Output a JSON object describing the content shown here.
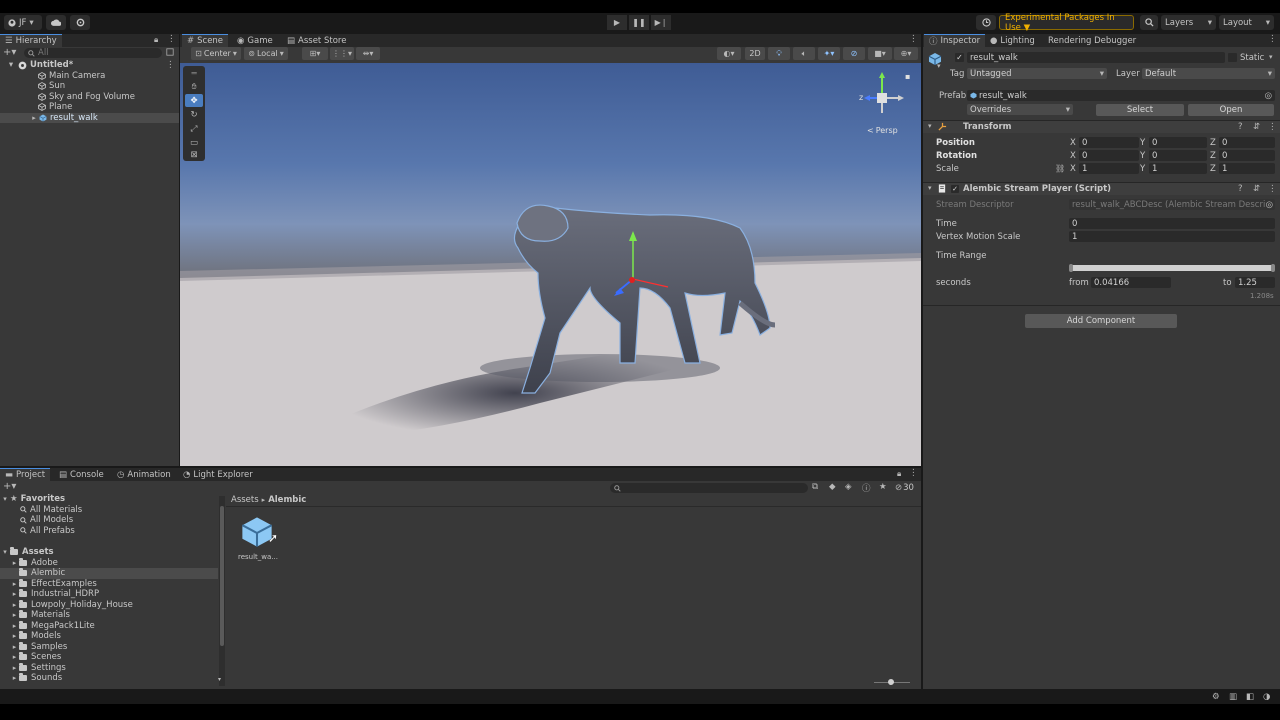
{
  "topbar": {
    "account": "JF",
    "experimental_label": "Experimental Packages In Use ▼",
    "layers_label": "Layers",
    "layout_label": "Layout"
  },
  "hierarchy": {
    "tab_label": "Hierarchy",
    "search_placeholder": "All",
    "scene_name": "Untitled*",
    "items": [
      {
        "label": "Main Camera"
      },
      {
        "label": "Sun"
      },
      {
        "label": "Sky and Fog Volume"
      },
      {
        "label": "Plane"
      },
      {
        "label": "result_walk"
      }
    ]
  },
  "scene": {
    "tabs": [
      {
        "label": "Scene"
      },
      {
        "label": "Game"
      },
      {
        "label": "Asset Store"
      }
    ],
    "pivot_label": "Center",
    "space_label": "Local",
    "mode_2d": "2D",
    "persp_label": "Persp",
    "gizmo_z": "z",
    "gizmo_x": "x"
  },
  "inspector": {
    "tabs": [
      {
        "label": "Inspector"
      },
      {
        "label": "Lighting"
      },
      {
        "label": "Rendering Debugger"
      }
    ],
    "object_name": "result_walk",
    "static_label": "Static",
    "tag_label": "Tag",
    "tag_value": "Untagged",
    "layer_label": "Layer",
    "layer_value": "Default",
    "prefab_label": "Prefab",
    "prefab_value": "result_walk",
    "overrides_label": "Overrides",
    "select_label": "Select",
    "open_label": "Open",
    "transform": {
      "title": "Transform",
      "position_label": "Position",
      "rotation_label": "Rotation",
      "scale_label": "Scale",
      "axis_x": "X",
      "axis_y": "Y",
      "axis_z": "Z",
      "position": [
        "0",
        "0",
        "0"
      ],
      "rotation": [
        "0",
        "0",
        "0"
      ],
      "scale": [
        "1",
        "1",
        "1"
      ]
    },
    "alembic": {
      "title": "Alembic Stream Player (Script)",
      "stream_descriptor_label": "Stream Descriptor",
      "stream_descriptor_value": "result_walk_ABCDesc (Alembic Stream Descripto",
      "time_label": "Time",
      "time_value": "0",
      "vms_label": "Vertex Motion Scale",
      "vms_value": "1",
      "time_range_label": "Time Range",
      "seconds_label": "seconds",
      "from_label": "from",
      "from_value": "0.04166",
      "to_label": "to",
      "to_value": "1.25",
      "duration": "1.208s"
    },
    "add_component_label": "Add Component"
  },
  "project": {
    "tabs": [
      {
        "label": "Project"
      },
      {
        "label": "Console"
      },
      {
        "label": "Animation"
      },
      {
        "label": "Light Explorer"
      }
    ],
    "favorites_label": "Favorites",
    "favorites": [
      {
        "label": "All Materials"
      },
      {
        "label": "All Models"
      },
      {
        "label": "All Prefabs"
      }
    ],
    "assets_label": "Assets",
    "folders": [
      {
        "label": "Adobe"
      },
      {
        "label": "Alembic"
      },
      {
        "label": "EffectExamples"
      },
      {
        "label": "Industrial_HDRP"
      },
      {
        "label": "Lowpoly_Holiday_House"
      },
      {
        "label": "Materials"
      },
      {
        "label": "MegaPack1Lite"
      },
      {
        "label": "Models"
      },
      {
        "label": "Samples"
      },
      {
        "label": "Scenes"
      },
      {
        "label": "Settings"
      },
      {
        "label": "Sounds"
      }
    ],
    "breadcrumb_root": "Assets",
    "breadcrumb_current": "Alembic",
    "asset_label": "result_wa...",
    "hidden_count": "30"
  }
}
